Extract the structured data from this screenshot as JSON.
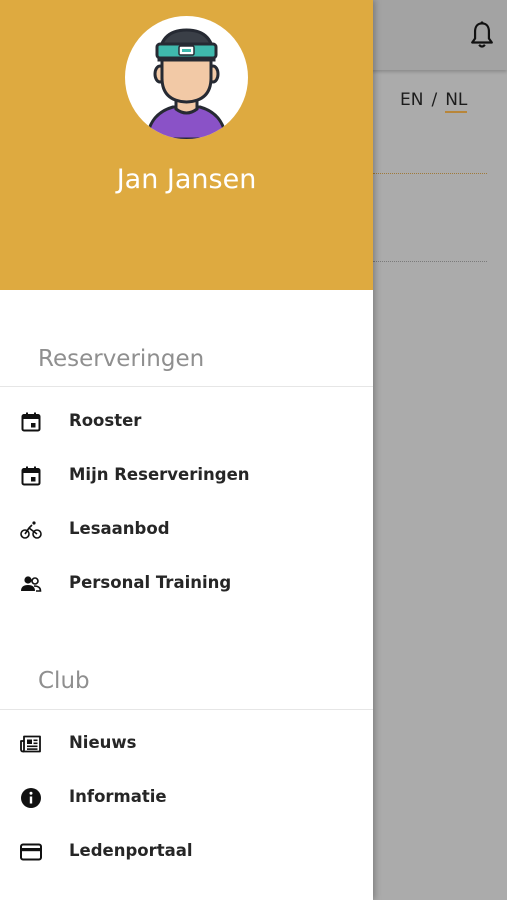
{
  "app": {
    "language": {
      "en": "EN",
      "separator": "/",
      "nl": "NL"
    }
  },
  "drawer": {
    "user": {
      "name": "Jan Jansen"
    },
    "sections": [
      {
        "title": "Reserveringen",
        "items": [
          {
            "label": "Rooster",
            "icon": "calendar-icon"
          },
          {
            "label": "Mijn Reserveringen",
            "icon": "calendar-icon"
          },
          {
            "label": "Lesaanbod",
            "icon": "bicycle-icon"
          },
          {
            "label": "Personal Training",
            "icon": "people-icon"
          }
        ]
      },
      {
        "title": "Club",
        "items": [
          {
            "label": "Nieuws",
            "icon": "newspaper-icon"
          },
          {
            "label": "Informatie",
            "icon": "info-icon"
          },
          {
            "label": "Ledenportaal",
            "icon": "credit-card-icon"
          }
        ]
      }
    ]
  },
  "colors": {
    "header": "#deaa40",
    "overlay": "#ababab",
    "section_title": "#8f8f8f",
    "menu_text": "#262626"
  }
}
